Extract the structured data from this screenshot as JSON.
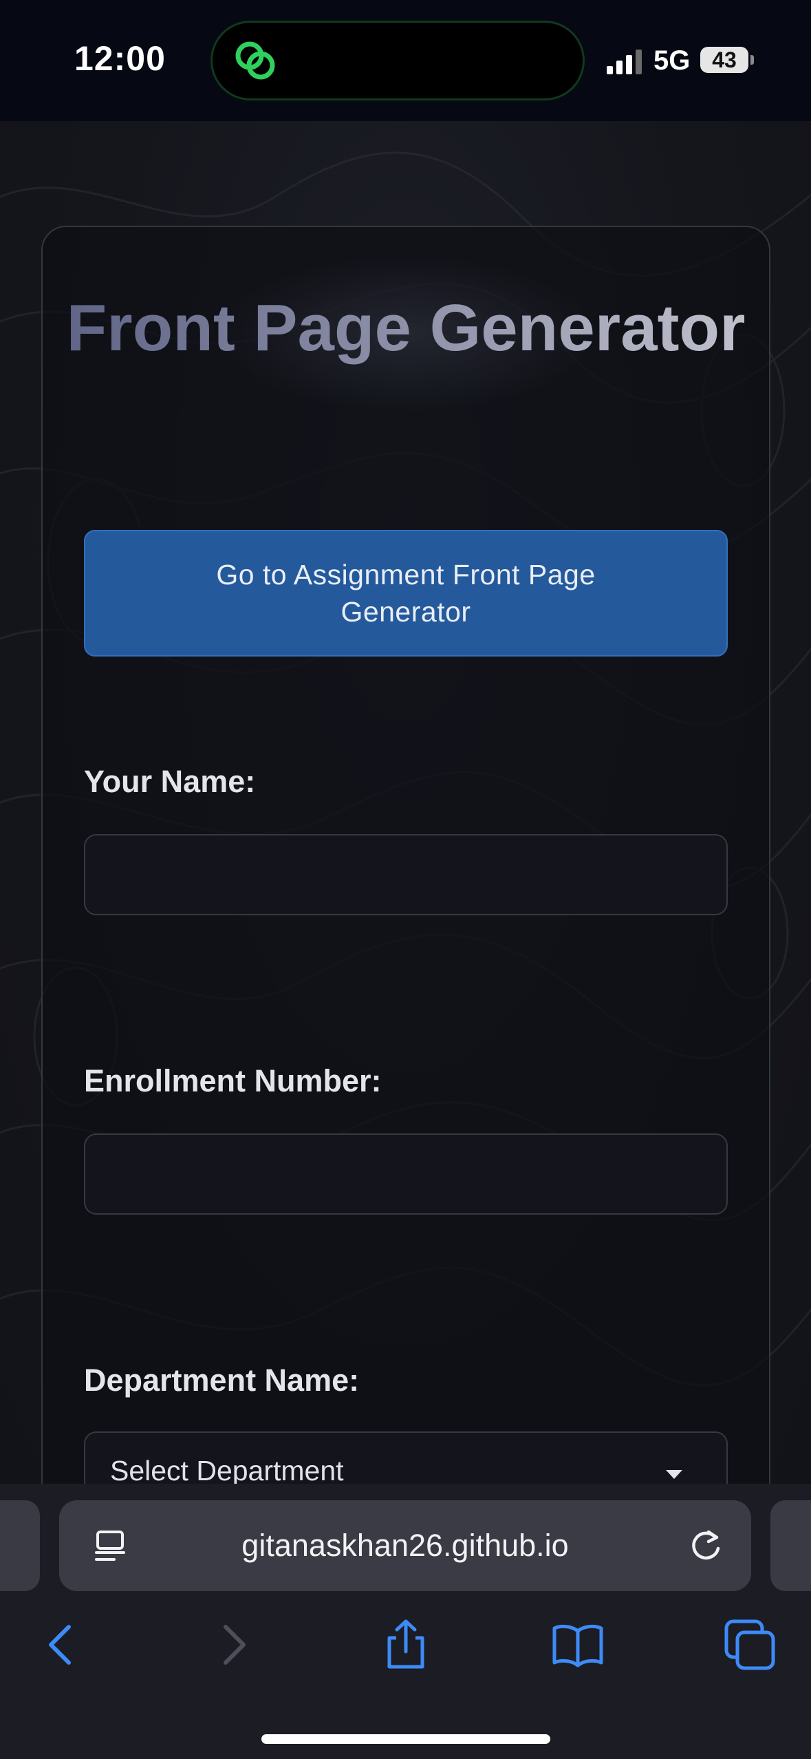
{
  "status_bar": {
    "time": "12:00",
    "network": "5G",
    "battery": "43"
  },
  "page": {
    "title": "Front Page Generator",
    "go_button_label": "Go to Assignment Front Page Generator",
    "fields": [
      {
        "label": "Your Name:",
        "value": ""
      },
      {
        "label": "Enrollment Number:",
        "value": ""
      }
    ],
    "department": {
      "label": "Department Name:",
      "selected": "Select Department"
    }
  },
  "browser": {
    "url": "gitanaskhan26.github.io"
  },
  "icons": {
    "island": "linked-rings-icon",
    "signal": "cellular-signal-icon",
    "reader": "page-menu-icon",
    "reload": "reload-icon",
    "back": "chevron-left-icon",
    "forward": "chevron-right-icon",
    "share": "share-icon",
    "bookmarks": "book-icon",
    "tabs": "tabs-icon"
  },
  "colors": {
    "accent_button": "#245a9c",
    "island_accent": "#2fd15c",
    "browser_blue": "#3d8bf7",
    "page_background": "#121319"
  }
}
